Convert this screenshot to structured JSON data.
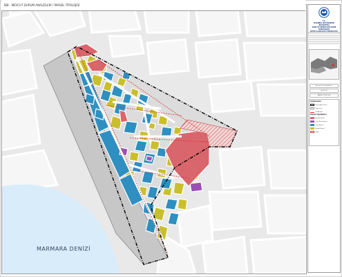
{
  "header": {
    "title": "İBB - MEVCUT DURUM ANALİZLERİ / PARSEL TİPOLOJİSİ"
  },
  "map": {
    "sea_label": "MARMARA DENİZİ"
  },
  "sidebar": {
    "org_lines": [
      "T.C.",
      "İSTANBUL BÜYÜKŞEHİR BELEDİYESİ",
      "İMAR VE ŞEHİRCİLİK DAİRE BAŞKANLIĞI",
      "ŞEHİR PLANLAMA MÜDÜRLÜĞÜ"
    ],
    "info_1": "Mevcut Durum Analizleri",
    "info_2": "Harita 01",
    "info_3": "PARSEL TİPOLOJİSİ"
  },
  "legend": {
    "title": "Açıklamalar",
    "items": [
      {
        "label": "Proje Alanı Sınırı",
        "color": "#000000",
        "style": "dashed-outline"
      },
      {
        "label": "Yapı Sınırı",
        "color": "#999999",
        "style": "outline"
      },
      {
        "label": "Yol Aksları",
        "color": "#d62f2f",
        "style": "dashed-line"
      }
    ],
    "parcel_title": "Parsel Tipolojileri",
    "parcels": [
      {
        "label": "Büyük Parsel",
        "color": "#d9666c"
      },
      {
        "label": "Orta Üstü Parsel",
        "color": "#9b4fb5"
      },
      {
        "label": "Orta Parsel",
        "color": "#2e8fc0"
      },
      {
        "label": "Küçük Parsel",
        "color": "#c9bf2e"
      },
      {
        "label": "Diğer",
        "color": "#f2d7d5"
      }
    ]
  },
  "colors": {
    "large": "#d9666c",
    "upper_mid": "#9b4fb5",
    "mid": "#2e8fc0",
    "small": "#c9bf2e",
    "road": "#ffffff",
    "ground": "#e9e9ea",
    "sea": "#d9ecfa",
    "pier": "#c7c7c7"
  }
}
